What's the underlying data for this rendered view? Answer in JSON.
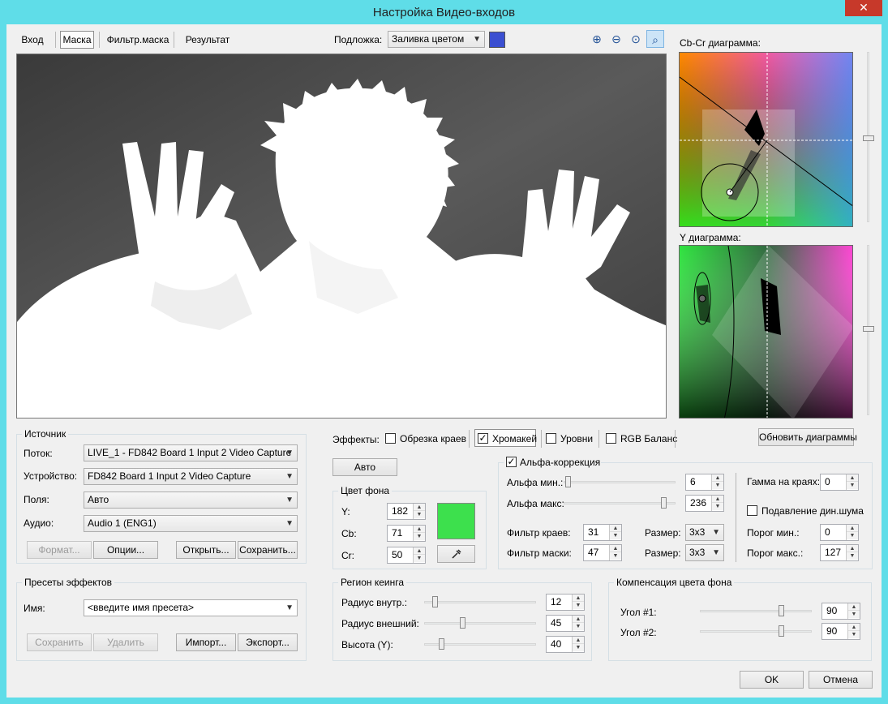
{
  "window": {
    "title": "Настройка Видео-входов",
    "close_glyph": "✕"
  },
  "tabs": [
    {
      "label": "Вход"
    },
    {
      "label": "Маска"
    },
    {
      "label": "Фильтр.маска"
    },
    {
      "label": "Результат"
    }
  ],
  "backdrop": {
    "label": "Подложка:",
    "value": "Заливка цветом",
    "swatch_color": "#3b4fd1"
  },
  "zoom_icons": [
    "zoom-in-icon",
    "zoom-out-icon",
    "zoom-100-icon",
    "zoom-fit-icon"
  ],
  "zoom_glyphs": {
    "in": "⊕",
    "out": "⊖",
    "reset": "⊙",
    "fit": "⌕"
  },
  "diagrams": {
    "cbcr_title": "Cb-Cr диаграмма:",
    "y_title": "Y диаграмма:"
  },
  "source": {
    "title": "Источник",
    "stream_label": "Поток:",
    "stream_value": "LIVE_1 - FD842 Board 1 Input 2 Video Capture",
    "device_label": "Устройство:",
    "device_value": "FD842 Board 1 Input 2 Video Capture",
    "fields_label": "Поля:",
    "fields_value": "Авто",
    "audio_label": "Аудио:",
    "audio_value": "Audio 1 (ENG1)",
    "format_btn": "Формат...",
    "options_btn": "Опции...",
    "open_btn": "Открыть...",
    "save_btn": "Сохранить..."
  },
  "presets": {
    "title": "Пресеты эффектов",
    "name_label": "Имя:",
    "name_placeholder": "<введите имя пресета>",
    "save_btn": "Сохранить",
    "delete_btn": "Удалить",
    "import_btn": "Импорт...",
    "export_btn": "Экспорт..."
  },
  "effects": {
    "label": "Эффекты:",
    "edge_trim": "Обрезка краев",
    "chromakey": "Хромакей",
    "levels": "Уровни",
    "rgb_balance": "RGB Баланс",
    "refresh_btn": "Обновить диаграммы",
    "auto_btn": "Авто",
    "check_glyph": "✓"
  },
  "bg_color": {
    "title": "Цвет фона",
    "y_label": "Y:",
    "y_value": "182",
    "cb_label": "Cb:",
    "cb_value": "71",
    "cr_label": "Cr:",
    "cr_value": "50",
    "swatch_color": "#3de04d",
    "eyedropper_icon": "eyedropper-icon"
  },
  "alpha": {
    "title": "Альфа-коррекция",
    "min_label": "Альфа мин.:",
    "min_value": "6",
    "max_label": "Альфа макс:",
    "max_value": "236",
    "edge_filter_label": "Фильтр краев:",
    "edge_filter_value": "31",
    "mask_filter_label": "Фильтр маски:",
    "mask_filter_value": "47",
    "size_label": "Размер:",
    "size1_value": "3x3",
    "size2_value": "3x3",
    "gamma_label": "Гамма на краях:",
    "gamma_value": "0",
    "noise_label": "Подавление дин.шума",
    "thr_min_label": "Порог мин.:",
    "thr_min_value": "0",
    "thr_max_label": "Порог макс.:",
    "thr_max_value": "127"
  },
  "keying": {
    "title": "Регион кеинга",
    "inner_label": "Радиус внутр.:",
    "inner_value": "12",
    "outer_label": "Радиус внешний:",
    "outer_value": "45",
    "height_label": "Высота (Y):",
    "height_value": "40"
  },
  "compensation": {
    "title": "Компенсация цвета фона",
    "angle1_label": "Угол #1:",
    "angle1_value": "90",
    "angle2_label": "Угол #2:",
    "angle2_value": "90"
  },
  "footer": {
    "ok": "OK",
    "cancel": "Отмена"
  },
  "spin_glyphs": {
    "up": "▲",
    "down": "▼",
    "combo": "▼"
  }
}
